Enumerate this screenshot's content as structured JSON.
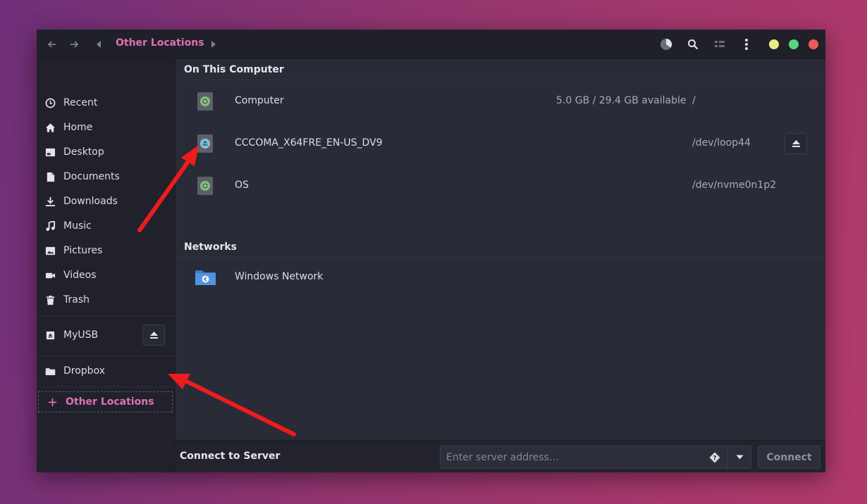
{
  "headerbar": {
    "breadcrumb": "Other Locations",
    "colors": {
      "accent": "#e16fb5",
      "minimize": "#e9ec86",
      "maximize": "#55d67a",
      "close": "#ee5a5a"
    }
  },
  "sidebar": {
    "items": [
      {
        "label": "Recent",
        "icon": "clock-icon"
      },
      {
        "label": "Home",
        "icon": "home-icon"
      },
      {
        "label": "Desktop",
        "icon": "desktop-icon"
      },
      {
        "label": "Documents",
        "icon": "document-icon"
      },
      {
        "label": "Downloads",
        "icon": "download-icon"
      },
      {
        "label": "Music",
        "icon": "music-icon"
      },
      {
        "label": "Pictures",
        "icon": "picture-icon"
      },
      {
        "label": "Videos",
        "icon": "video-camera-icon"
      },
      {
        "label": "Trash",
        "icon": "trash-icon"
      }
    ],
    "devices": [
      {
        "label": "MyUSB",
        "icon": "usb-drive-icon"
      }
    ],
    "bookmarks": [
      {
        "label": "Dropbox",
        "icon": "folder-icon"
      }
    ],
    "other_locations": "Other Locations"
  },
  "main": {
    "on_this_computer": {
      "title": "On This Computer",
      "rows": [
        {
          "name": "Computer",
          "available": "5.0 GB / 29.4 GB available",
          "path": "/"
        },
        {
          "name": "CCCOMA_X64FRE_EN-US_DV9",
          "available": "",
          "path": "/dev/loop44"
        },
        {
          "name": "OS",
          "available": "",
          "path": "/dev/nvme0n1p2"
        }
      ]
    },
    "networks": {
      "title": "Networks",
      "rows": [
        {
          "name": "Windows Network"
        }
      ]
    }
  },
  "bottombar": {
    "label": "Connect to Server",
    "placeholder": "Enter server address…",
    "connect_label": "Connect"
  }
}
